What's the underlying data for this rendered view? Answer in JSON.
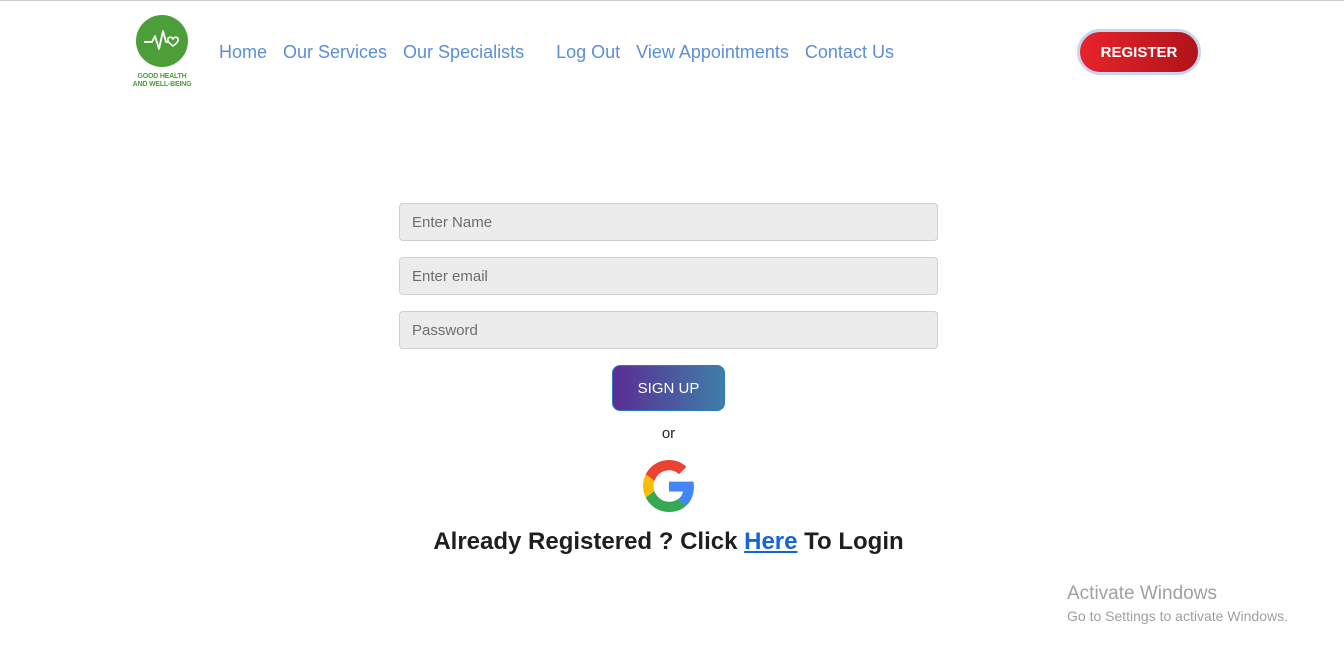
{
  "logo": {
    "line1": "GOOD HEALTH",
    "line2": "AND WELL-BEING",
    "icon": "heartbeat-heart-icon",
    "color": "#4c9f38"
  },
  "nav": {
    "items": [
      {
        "label": "Home"
      },
      {
        "label": "Our Services"
      },
      {
        "label": "Our Specialists"
      },
      {
        "label": "Log Out"
      },
      {
        "label": "View Appointments"
      },
      {
        "label": "Contact Us"
      }
    ],
    "color": "#5a8ed8"
  },
  "header": {
    "register_label": "REGISTER",
    "register_color": "#d91e26"
  },
  "form": {
    "name_placeholder": "Enter Name",
    "email_placeholder": "Enter email",
    "password_placeholder": "Password",
    "signup_label": "SIGN UP",
    "or_text": "or",
    "google_icon": "google-g-icon"
  },
  "login_prompt": {
    "before": "Already Registered ? Click ",
    "link": "Here",
    "after": " To Login"
  },
  "watermark": {
    "title": "Activate Windows",
    "subtitle": "Go to Settings to activate Windows."
  }
}
